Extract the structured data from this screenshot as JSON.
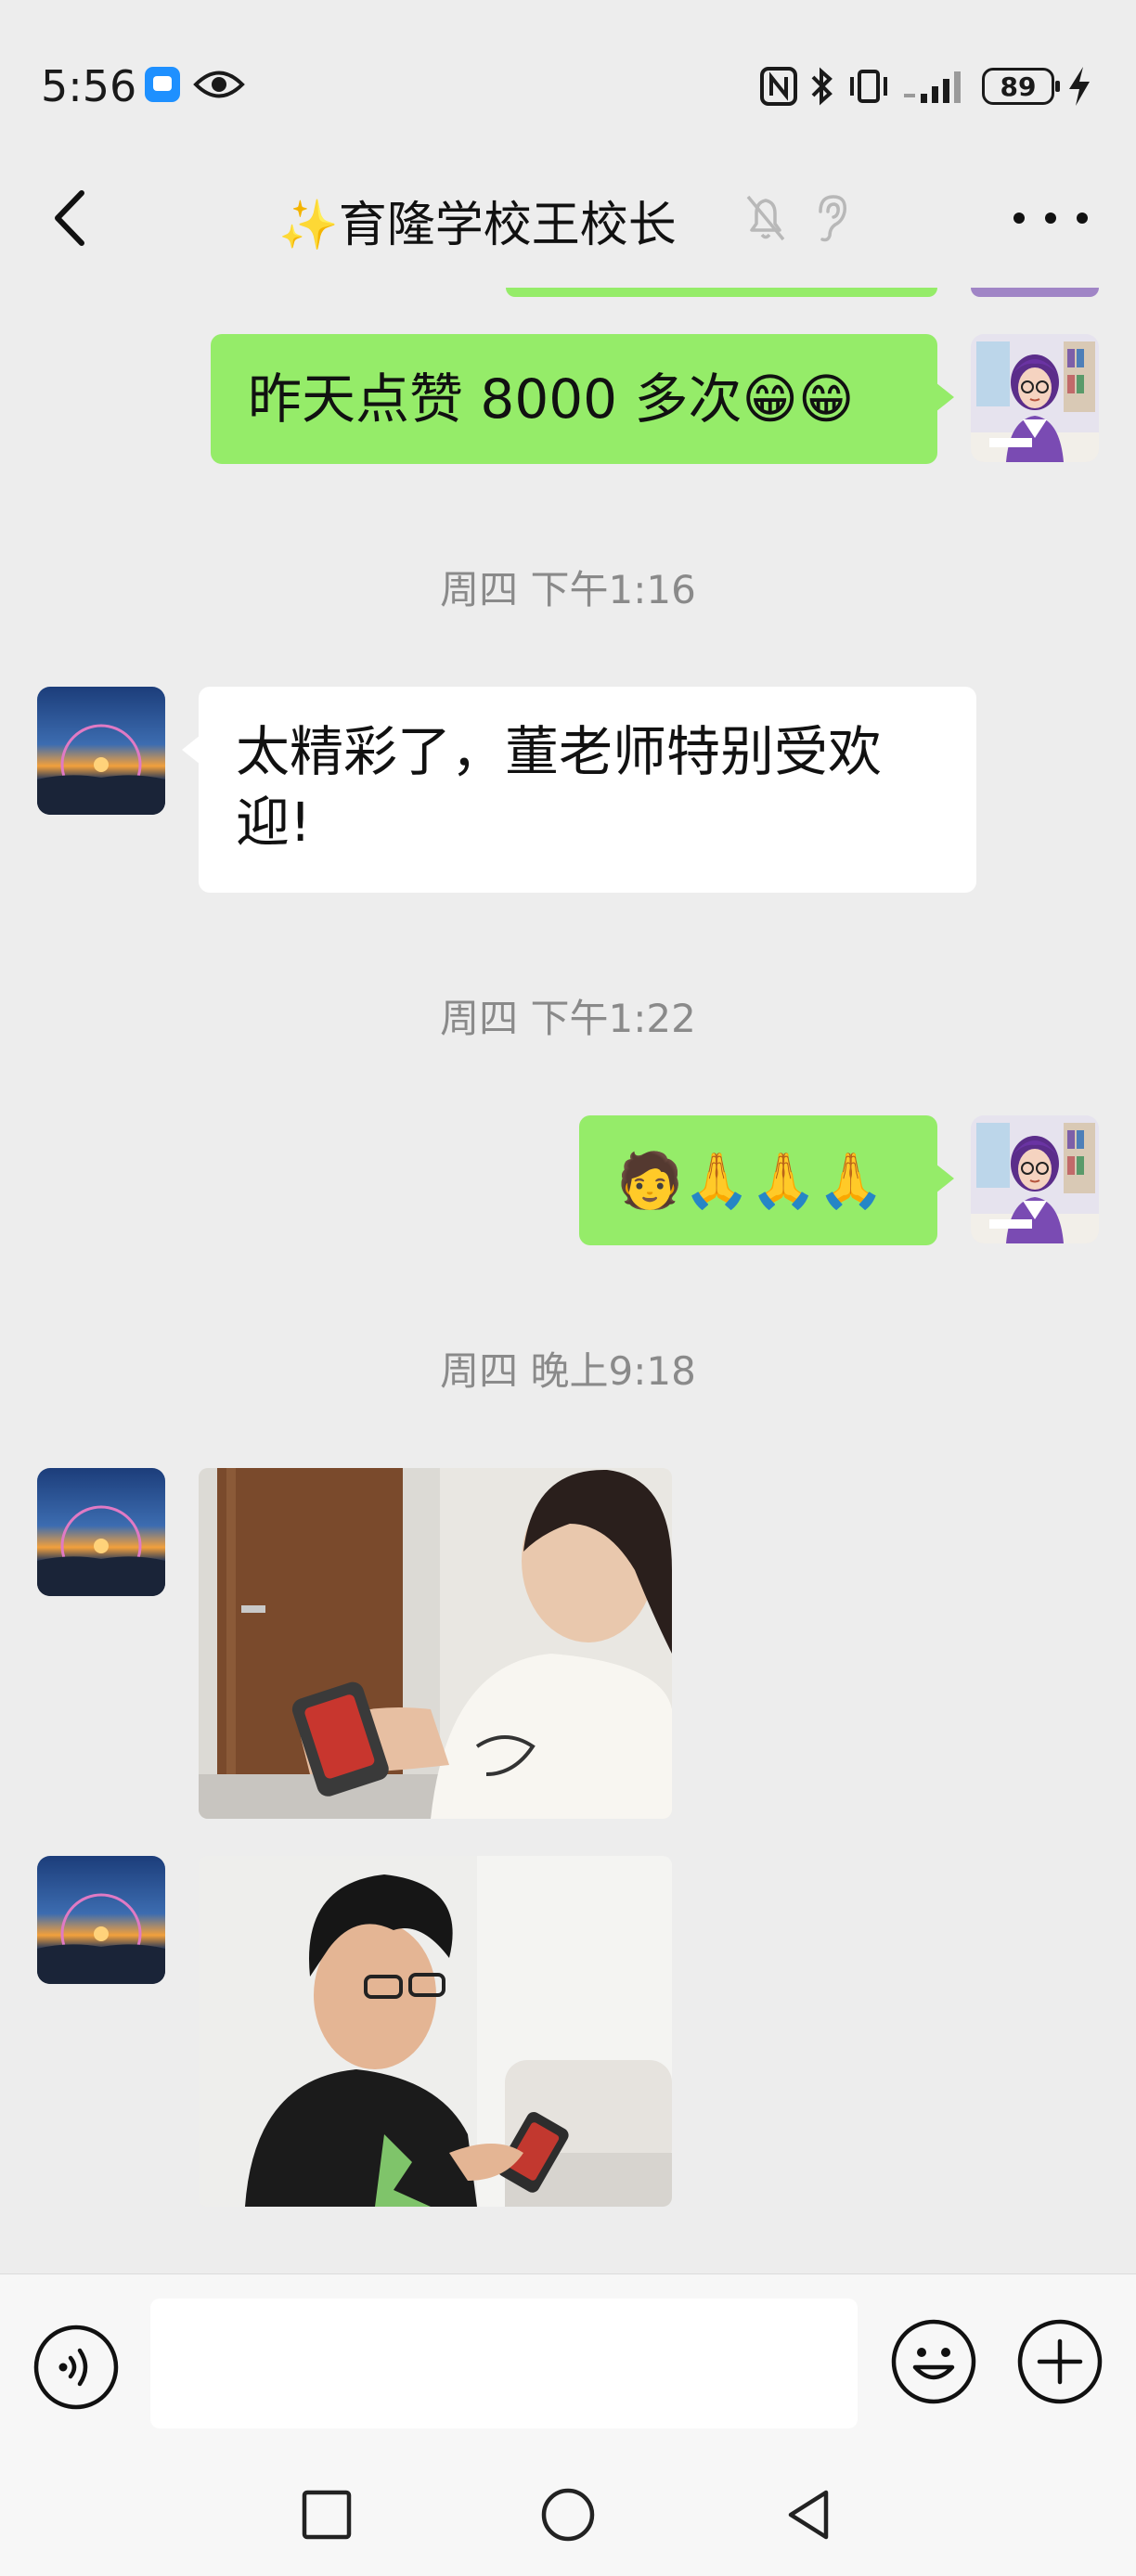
{
  "status_bar": {
    "time": "5:56",
    "battery": "89"
  },
  "header": {
    "title": "✨育隆学校王校长"
  },
  "messages": {
    "m1": {
      "sender": "me",
      "text": "昨天点赞 8000 多次😁😁"
    },
    "t1": "周四 下午1:16",
    "m2": {
      "sender": "other",
      "text": "太精彩了，董老师特别受欢迎!"
    },
    "t2": "周四 下午1:22",
    "m3": {
      "sender": "me",
      "text": "🧑🙏🙏🙏"
    },
    "t3": "周四 晚上9:18"
  },
  "colors": {
    "my_bubble": "#95ec69",
    "other_bubble": "#ffffff",
    "chat_background": "#ededed",
    "timestamp_text": "#8a8a8a"
  },
  "input_bar": {
    "value": "",
    "placeholder": ""
  }
}
